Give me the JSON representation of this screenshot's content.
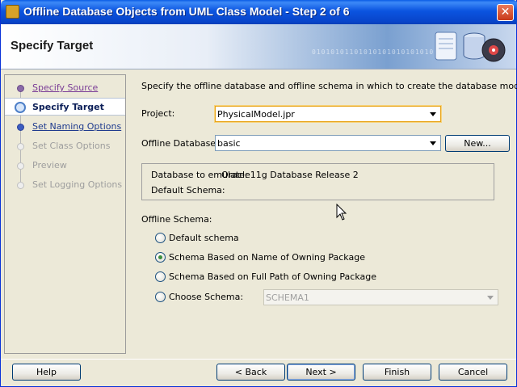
{
  "window": {
    "title": "Offline Database Objects from UML Class Model - Step 2 of 6",
    "close_glyph": "✕"
  },
  "header": {
    "heading": "Specify Target",
    "binary_text": "01010101101010101010101010"
  },
  "nav": {
    "items": [
      {
        "label": "Specify Source",
        "state": "visited"
      },
      {
        "label": "Specify Target",
        "state": "current"
      },
      {
        "label": "Set Naming Options",
        "state": "link"
      },
      {
        "label": "Set Class Options",
        "state": "disabled"
      },
      {
        "label": "Preview",
        "state": "disabled"
      },
      {
        "label": "Set Logging Options",
        "state": "disabled"
      }
    ]
  },
  "main": {
    "description": "Specify the offline database and offline schema in which to create the database model.",
    "project_label": "Project:",
    "project_value": "PhysicalModel.jpr",
    "offline_db_label": "Offline Database:",
    "offline_db_value": "basic",
    "new_button": "New...",
    "db_to_emulate_label": "Database to emulate:",
    "db_to_emulate_value": "Oracle11g Database Release 2",
    "default_schema_label": "Default Schema:",
    "offline_schema_label": "Offline Schema:",
    "radios": [
      {
        "label": "Default schema",
        "checked": false
      },
      {
        "label": "Schema Based on Name of Owning Package",
        "checked": true
      },
      {
        "label": "Schema Based on Full Path of Owning Package",
        "checked": false
      },
      {
        "label": "Choose Schema:",
        "checked": false
      }
    ],
    "choose_schema_value": "SCHEMA1"
  },
  "footer": {
    "help": "Help",
    "back": "< Back",
    "next": "Next >",
    "finish": "Finish",
    "cancel": "Cancel"
  },
  "colors": {
    "titlebar": "#0b54e0",
    "focus": "#e8a317"
  }
}
